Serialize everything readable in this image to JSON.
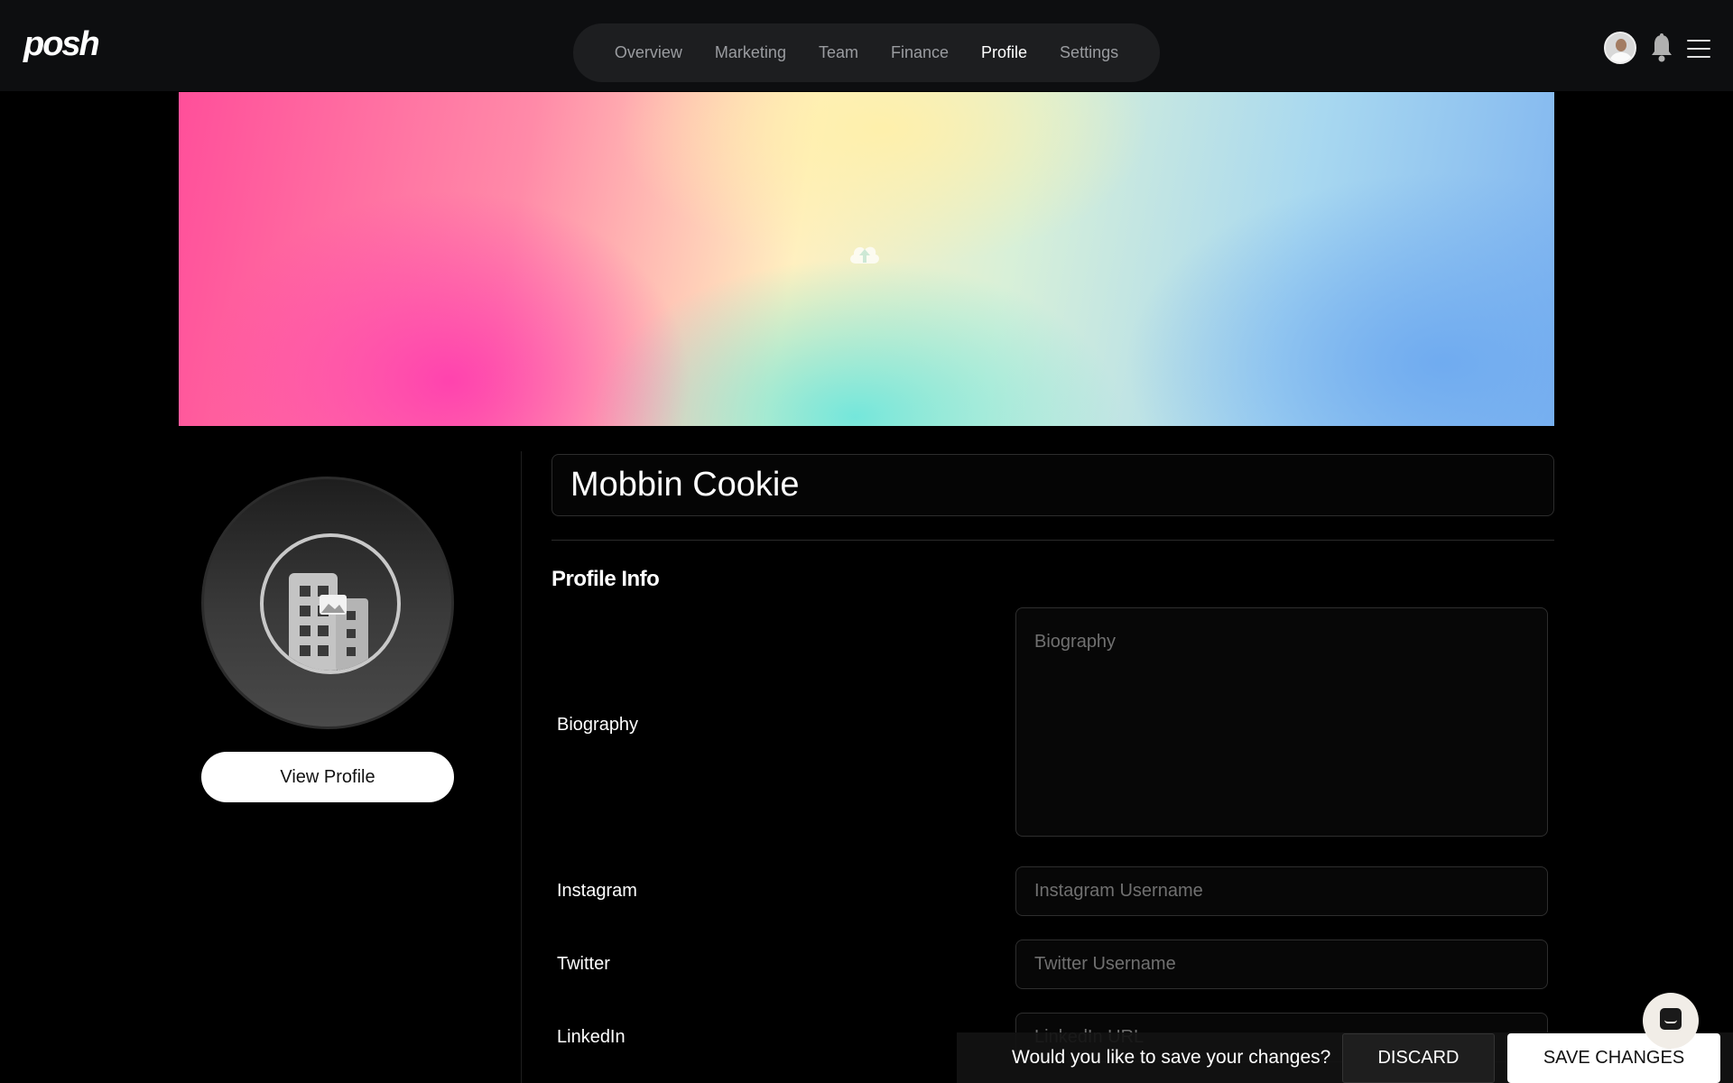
{
  "header": {
    "logo": "posh",
    "nav": [
      "Overview",
      "Marketing",
      "Team",
      "Finance",
      "Profile",
      "Settings"
    ],
    "active_nav": "Profile"
  },
  "banner": {
    "upload_icon": "cloud-upload-icon"
  },
  "profile": {
    "view_profile_label": "View Profile",
    "avatar_icon": "building-icon"
  },
  "form": {
    "name_value": "Mobbin Cookie",
    "section_title": "Profile Info",
    "fields": [
      {
        "label": "Biography",
        "placeholder": "Biography"
      },
      {
        "label": "Instagram",
        "placeholder": "Instagram Username"
      },
      {
        "label": "Twitter",
        "placeholder": "Twitter Username"
      },
      {
        "label": "LinkedIn",
        "placeholder": "LinkedIn URL"
      }
    ]
  },
  "save_bar": {
    "prompt": "Would you like to save your changes?",
    "discard_label": "DISCARD",
    "save_label": "SAVE CHANGES"
  },
  "colors": {
    "background": "#000000",
    "topbar": "#0d0e10",
    "nav_pill": "#1d1e20",
    "nav_inactive": "#9a9ca0",
    "nav_active": "#ffffff"
  }
}
